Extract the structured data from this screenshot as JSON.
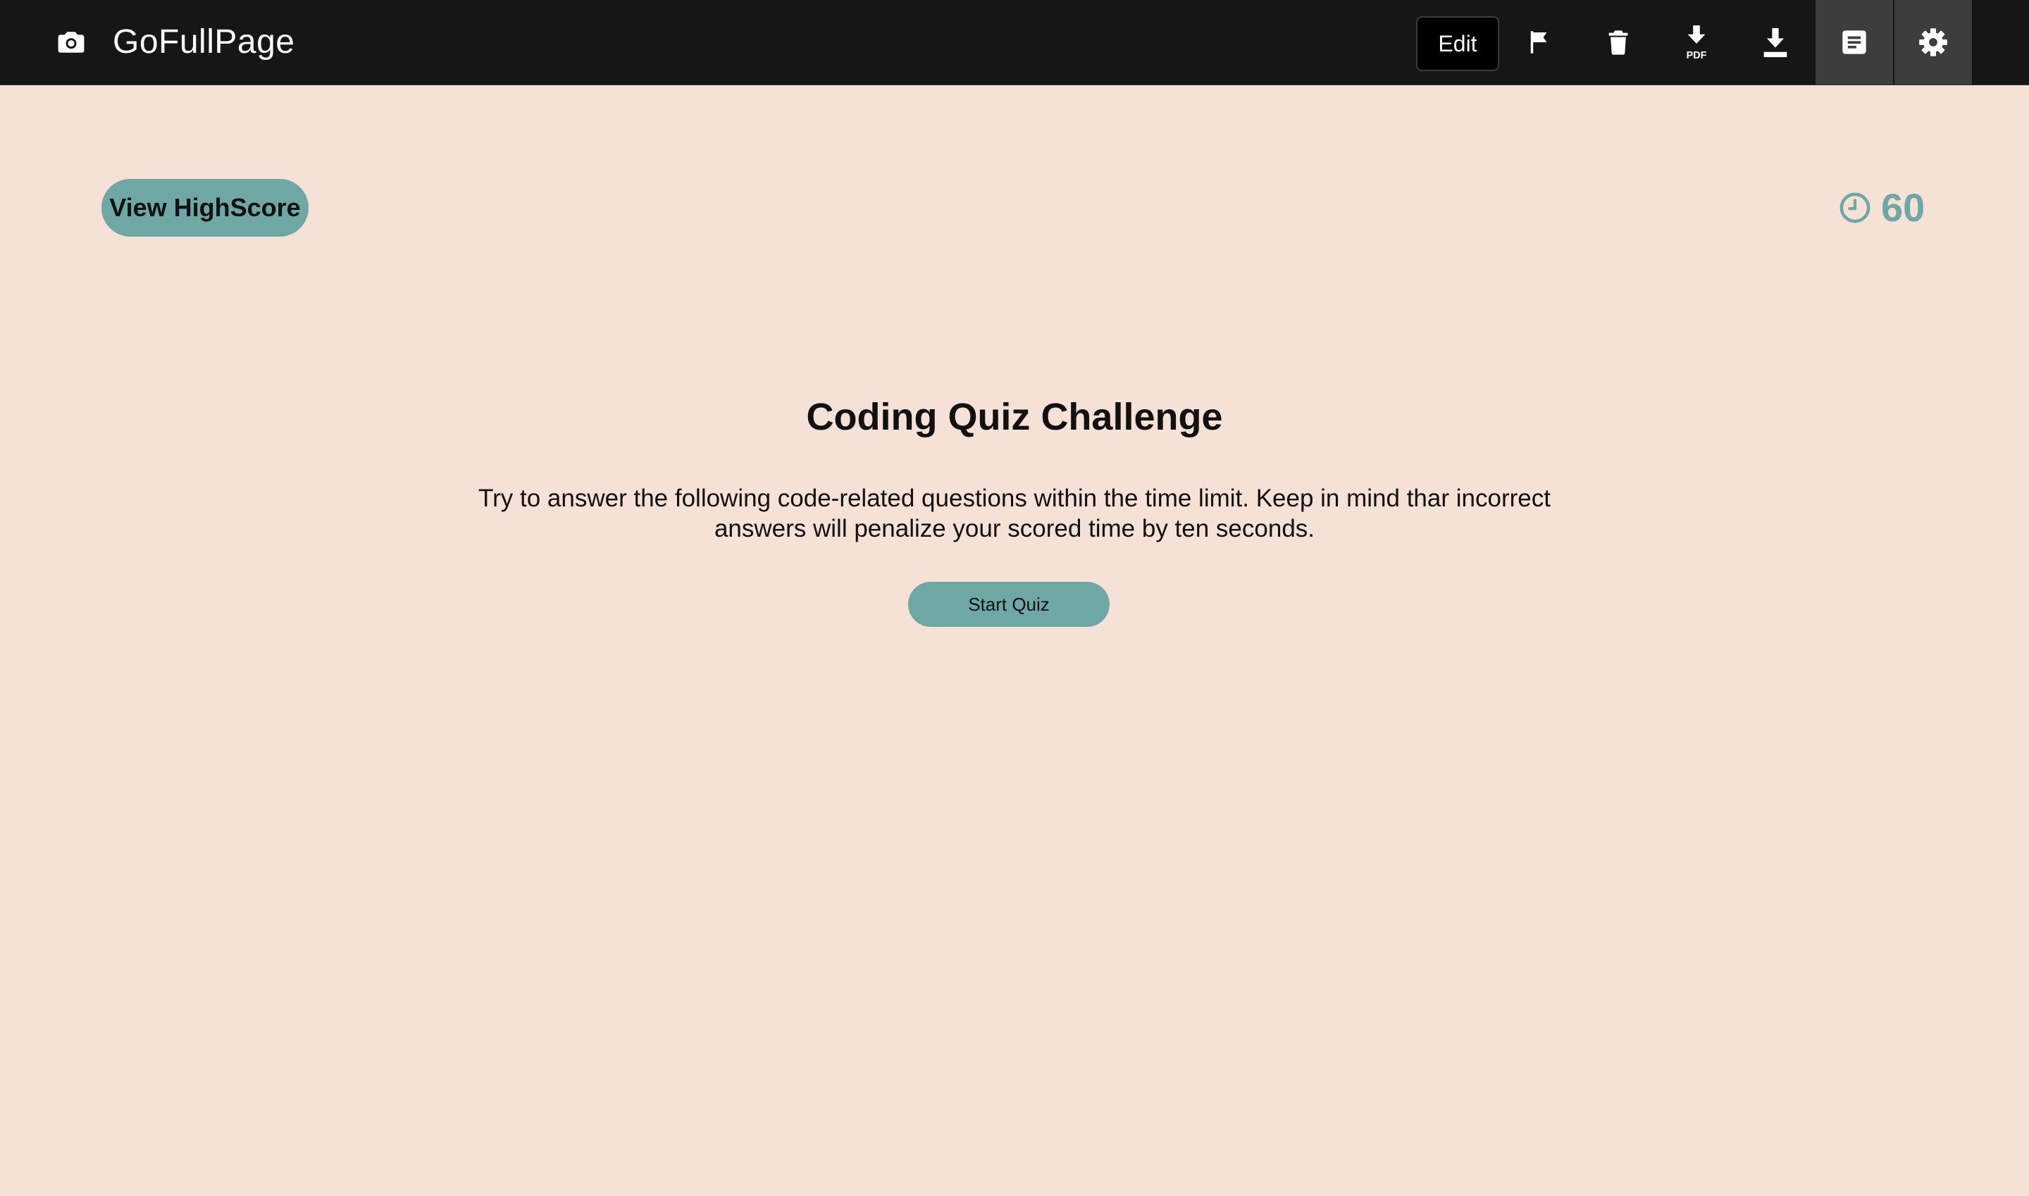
{
  "toolbar": {
    "brand_icon": "camera-icon",
    "brand_name": "GoFullPage",
    "edit_label": "Edit",
    "buttons": [
      {
        "name": "flag-button",
        "icon": "flag-icon"
      },
      {
        "name": "delete-button",
        "icon": "trash-icon"
      },
      {
        "name": "download-pdf-button",
        "icon": "download-pdf-icon",
        "icon_text": "PDF"
      },
      {
        "name": "download-button",
        "icon": "download-icon"
      },
      {
        "name": "notes-button",
        "icon": "document-icon",
        "active": true
      },
      {
        "name": "settings-button",
        "icon": "gear-icon",
        "active": true
      }
    ],
    "colors": {
      "background": "#161616",
      "active": "#3d3d3d",
      "icon": "#ffffff"
    }
  },
  "page": {
    "highscore_label": "View HighScore",
    "timer_icon": "clock-icon",
    "timer_value": "60",
    "title": "Coding Quiz Challenge",
    "description": "Try to answer the following code-related questions within the time limit. Keep in mind thar incorrect answers will penalize your scored time by ten seconds.",
    "start_label": "Start Quiz",
    "colors": {
      "background": "#f5e1d6",
      "accent": "#6fa7a5",
      "text": "#111111"
    }
  }
}
